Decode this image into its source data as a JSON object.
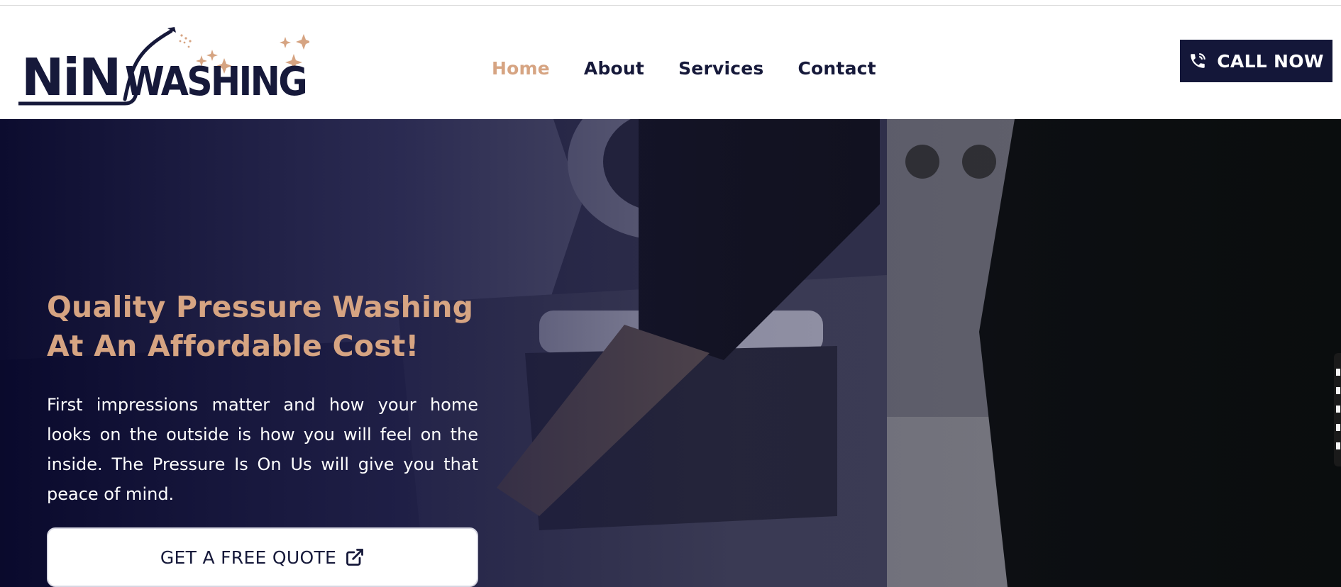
{
  "logo": {
    "text": "NINSWASHING",
    "part1": "NiN",
    "part2": "WASHING",
    "icon": "logo-sparkles-icon"
  },
  "nav": {
    "items": [
      {
        "label": "Home",
        "active": true
      },
      {
        "label": "About",
        "active": false
      },
      {
        "label": "Services",
        "active": false
      },
      {
        "label": "Contact",
        "active": false
      }
    ]
  },
  "call_button": {
    "label": "CALL NOW",
    "icon": "phone-icon"
  },
  "hero": {
    "title": "Quality Pressure Washing At An Affordable Cost!",
    "description": "First impressions matter and how your home looks on the outside is how you will feel on the inside. The Pressure Is On Us will give you that peace of mind.",
    "quote_button": {
      "label": "GET A FREE QUOTE",
      "icon": "external-link-icon"
    }
  },
  "colors": {
    "brand_navy": "#16193a",
    "accent_tan": "#d6a482",
    "button_navy": "#141739",
    "white": "#ffffff"
  }
}
